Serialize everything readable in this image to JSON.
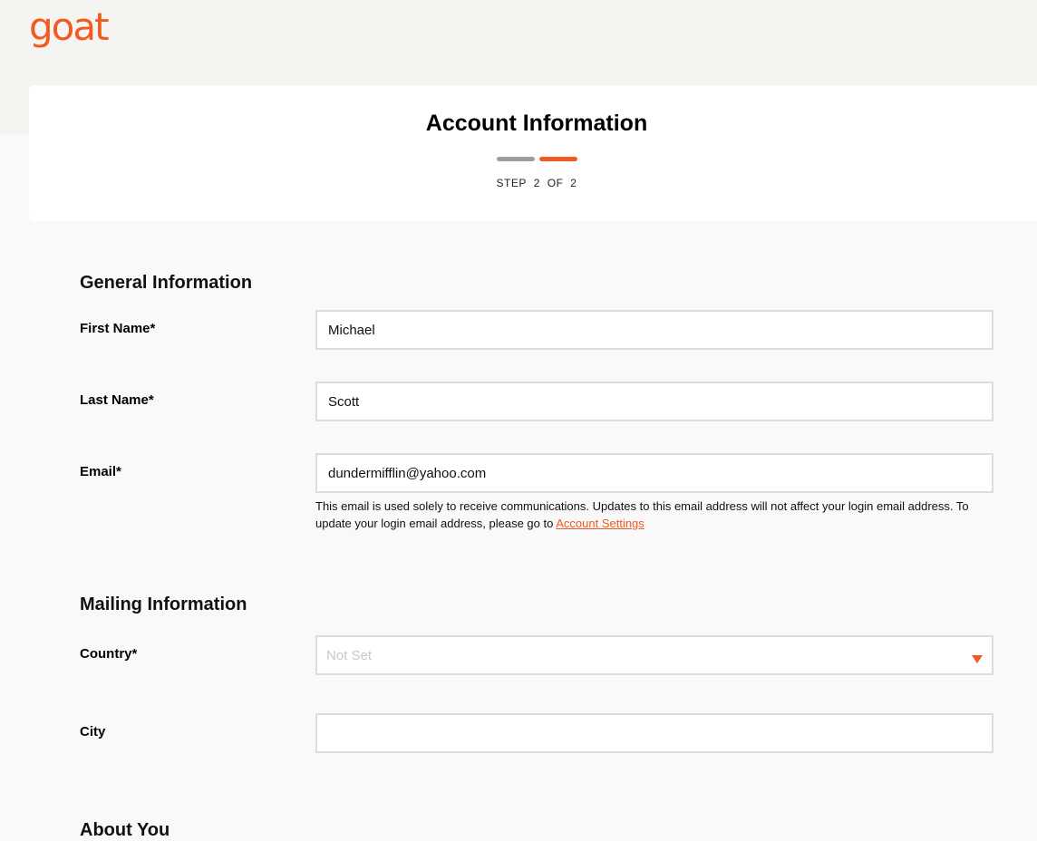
{
  "brand": {
    "logo_text": "goat",
    "accent_color": "#f15a22"
  },
  "header": {
    "title": "Account Information",
    "step": {
      "word": "STEP",
      "current": "2",
      "of": "OF",
      "total": "2"
    }
  },
  "general": {
    "title": "General Information",
    "first_name": {
      "label": "First Name*",
      "value": "Michael"
    },
    "last_name": {
      "label": "Last Name*",
      "value": "Scott"
    },
    "email": {
      "label": "Email*",
      "value": "dundermifflin@yahoo.com",
      "helper": "This email is used solely to receive communications. Updates to this email address will not affect your login email address. To update your login email address, please go to ",
      "helper_link": "Account Settings"
    }
  },
  "mailing": {
    "title": "Mailing Information",
    "country": {
      "label": "Country*",
      "value": "Not Set",
      "icon": "caret-down-icon"
    },
    "city": {
      "label": "City",
      "value": ""
    }
  },
  "about": {
    "title": "About You"
  }
}
